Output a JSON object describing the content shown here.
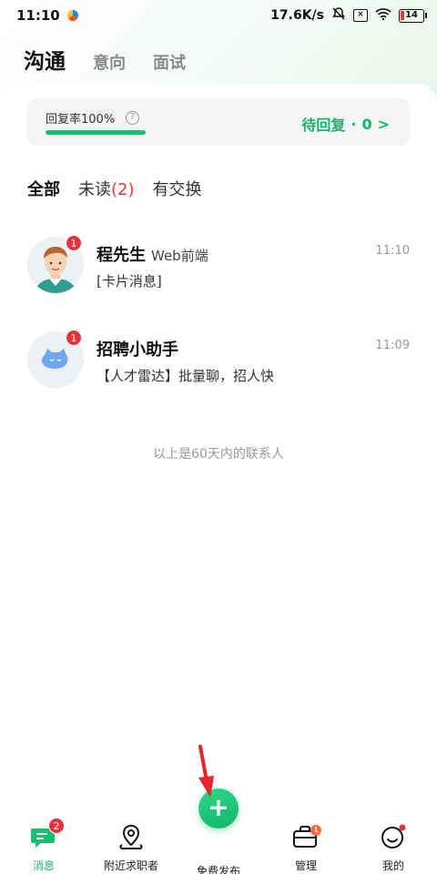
{
  "status_bar": {
    "time": "11:10",
    "net_speed": "17.6K/s",
    "battery": "14"
  },
  "header": {
    "tabs": [
      "沟通",
      "意向",
      "面试"
    ]
  },
  "reply_card": {
    "rate_label": "回复率100%",
    "help_symbol": "?",
    "rate_value": 1.0,
    "pending_label": "待回复",
    "pending_sep": "·",
    "pending_count": "0",
    "pending_arrow": ">"
  },
  "filters": {
    "all": "全部",
    "unread": "未读",
    "unread_count": "(2)",
    "exchanged": "有交换"
  },
  "conversations": [
    {
      "name": "程先生",
      "role": "Web前端",
      "time": "11:10",
      "message": "[卡片消息]",
      "badge": "1",
      "avatar_icon": "man-avatar-icon"
    },
    {
      "name": "招聘小助手",
      "role": "",
      "time": "11:09",
      "message": "【人才雷达】批量聊，招人快",
      "badge": "1",
      "avatar_icon": "blue-cat-avatar-icon"
    }
  ],
  "footer_note": "以上是60天内的联系人",
  "bottom_nav": {
    "items": [
      {
        "label": "消息",
        "icon": "message-icon",
        "badge": "2",
        "active": true
      },
      {
        "label": "附近求职者",
        "icon": "location-icon"
      },
      {
        "label": "免费发布",
        "icon": "plus-icon",
        "symbol": "+"
      },
      {
        "label": "管理",
        "icon": "briefcase-icon"
      },
      {
        "label": "我的",
        "icon": "smile-icon"
      }
    ]
  },
  "colors": {
    "accent": "#13b76a",
    "badge": "#e8323a",
    "arrow": "#e8232a"
  }
}
